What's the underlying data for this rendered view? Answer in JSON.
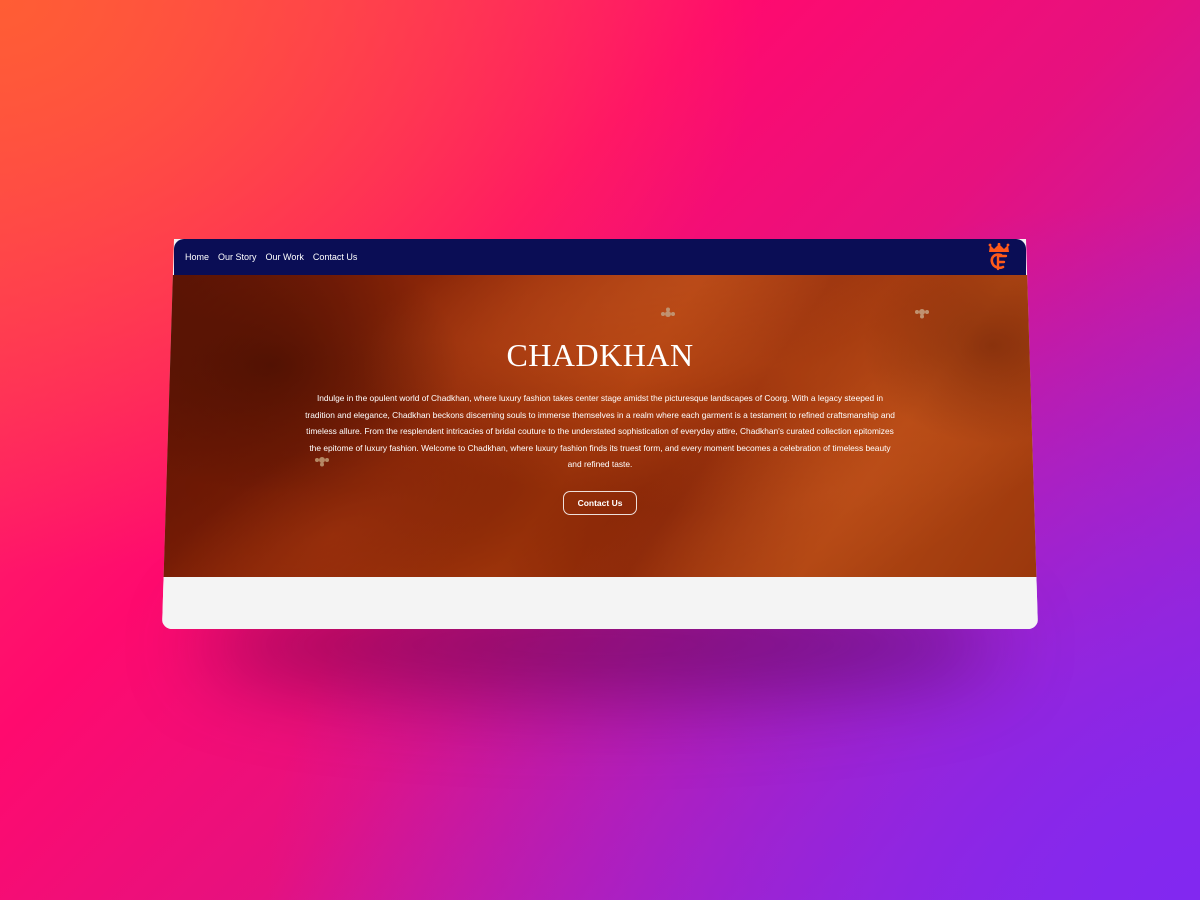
{
  "nav": {
    "links": [
      "Home",
      "Our Story",
      "Our Work",
      "Contact Us"
    ]
  },
  "logo": {
    "icon": "crown-monogram-icon",
    "color": "#ff5a1a"
  },
  "hero": {
    "title": "CHADKHAN",
    "description": "Indulge in the opulent world of Chadkhan, where luxury fashion takes center stage amidst the picturesque landscapes of Coorg. With a legacy steeped in tradition and elegance, Chadkhan beckons discerning souls to immerse themselves in a realm where each garment is a testament to refined craftsmanship and timeless allure. From the resplendent intricacies of bridal couture to the understated sophistication of everyday attire, Chadkhan's curated collection epitomizes the epitome of luxury fashion. Welcome to Chadkhan, where luxury fashion finds its truest form, and every moment becomes a celebration of timeless beauty and refined taste.",
    "button_label": "Contact Us"
  },
  "colors": {
    "navbar": "#0a0d55",
    "accent": "#ff5a1a",
    "hero_base": "#b63a0e"
  }
}
